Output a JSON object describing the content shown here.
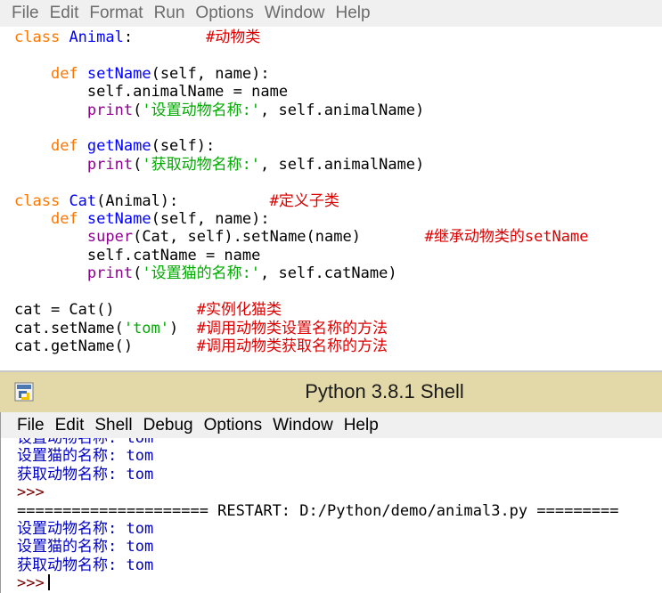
{
  "editor": {
    "menu": [
      "File",
      "Edit",
      "Format",
      "Run",
      "Options",
      "Window",
      "Help"
    ],
    "code": {
      "l1": {
        "kw": "class",
        "name": "Animal",
        "colon": ":",
        "pad": "        ",
        "cm": "#动物类"
      },
      "l3": {
        "kw": "def",
        "name": "setName",
        "rest": "(self, name):"
      },
      "l4": "self.animalName = name",
      "l5": {
        "bi": "print",
        "open": "(",
        "str": "'设置动物名称:'",
        "rest": ", self.animalName)"
      },
      "l7": {
        "kw": "def",
        "name": "getName",
        "rest": "(self):"
      },
      "l8": {
        "bi": "print",
        "open": "(",
        "str": "'获取动物名称:'",
        "rest": ", self.animalName)"
      },
      "l10": {
        "kw": "class",
        "name": "Cat",
        "rest": "(Animal):",
        "pad": "          ",
        "cm": "#定义子类"
      },
      "l11": {
        "kw": "def",
        "name": "setName",
        "rest": "(self, name):"
      },
      "l12": {
        "bi": "super",
        "rest": "(Cat, self).setName(name)",
        "pad": "       ",
        "cm": "#继承动物类的setName"
      },
      "l13": "self.catName = name",
      "l14": {
        "bi": "print",
        "open": "(",
        "str": "'设置猫的名称:'",
        "rest": ", self.catName)"
      },
      "l16": {
        "code": "cat = Cat()",
        "pad": "         ",
        "cm": "#实例化猫类"
      },
      "l17": {
        "pre": "cat.setName(",
        "str": "'tom'",
        "post": ")",
        "pad": "  ",
        "cm": "#调用动物类设置名称的方法"
      },
      "l18": {
        "code": "cat.getName()",
        "pad": "       ",
        "cm": "#调用动物类获取名称的方法"
      }
    }
  },
  "shell": {
    "title": "Python 3.8.1 Shell",
    "icon": "python-idle-icon",
    "menu": [
      "File",
      "Edit",
      "Shell",
      "Debug",
      "Options",
      "Window",
      "Help"
    ],
    "lines": {
      "cut": "设置动物名称: tom",
      "a1": "设置猫的名称: tom",
      "a2": "获取动物名称: tom",
      "p1": ">>>",
      "restart": "===================== RESTART: D:/Python/demo/animal3.py =========",
      "b1": "设置动物名称: tom",
      "b2": "设置猫的名称: tom",
      "b3": "获取动物名称: tom",
      "p2": ">>>"
    }
  },
  "colors": {
    "keyword": "#ff7700",
    "definition": "#0000ff",
    "builtin": "#900090",
    "string": "#00aa00",
    "comment": "#dd0000",
    "output": "#0000c0",
    "titlebar": "#e3d8a8"
  }
}
